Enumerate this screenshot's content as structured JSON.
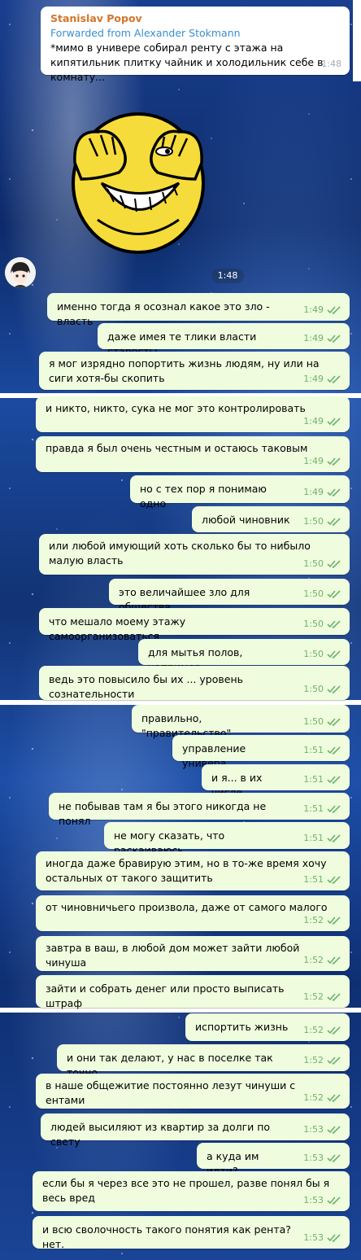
{
  "forwarded": {
    "sender": "Stanislav Popov",
    "forwarded_label": "Forwarded from Alexander Stokmann",
    "text": "*мимо в универе собирал ренту с этажа на кипятильник плитку чайник и холодильник себе в комнату...",
    "time": "1:48"
  },
  "sticker_time": "1:48",
  "messages": [
    {
      "text": "именно тогда я осознал какое это зло - власть",
      "time": "1:49"
    },
    {
      "text": "даже имея те тлики власти старосты",
      "time": "1:49"
    },
    {
      "text": "я мог изрядно попортить жизнь людям, ну или на сиги хотя-бы скопить",
      "time": "1:49"
    },
    {
      "text": "и никто, никто, сука не мог это контролировать",
      "time": "1:49"
    },
    {
      "text": "правда я был очень честным и остаюсь таковым",
      "time": "1:49"
    },
    {
      "text": "но с тех пор я понимаю одно",
      "time": "1:49"
    },
    {
      "text": "любой чиновник",
      "time": "1:50"
    },
    {
      "text": "или любой имующий хоть сколько бы то нибыло малую власть",
      "time": "1:50"
    },
    {
      "text": "это величайшее зло для общества",
      "time": "1:50"
    },
    {
      "text": "что мешало моему этажу самоорганизоваться",
      "time": "1:50"
    },
    {
      "text": "для мытья полов, например",
      "time": "1:50"
    },
    {
      "text": "ведь это повысило бы их ... уровень сознательности",
      "time": "1:50"
    },
    {
      "text": "правильно, \"правительство\"",
      "time": "1:50"
    },
    {
      "text": "управление универа",
      "time": "1:51"
    },
    {
      "text": "и я... в их числе",
      "time": "1:51"
    },
    {
      "text": "не побывав там я бы этого никогда не понял",
      "time": "1:51"
    },
    {
      "text": "не могу сказать, что раскаиваюсь",
      "time": "1:51"
    },
    {
      "text": "иногда даже бравирую этим, но в то-же время хочу остальных от такого защитить",
      "time": "1:51"
    },
    {
      "text": "от чиновничьего произвола, даже от самого малого",
      "time": "1:52"
    },
    {
      "text": "завтра в ваш, в любой дом может зайти любой чинуша",
      "time": "1:52"
    },
    {
      "text": "зайти и собрать денег или просто выписать штраф",
      "time": "1:52"
    },
    {
      "text": "испортить жизнь",
      "time": "1:52"
    },
    {
      "text": "и они так делают, у нас в поселке так точно",
      "time": "1:52"
    },
    {
      "text": "в наше общежитие постоянно лезут чинуши с ентами",
      "time": "1:52"
    },
    {
      "text": "людей высиляют из квартир за долги по свету",
      "time": "1:53"
    },
    {
      "text": "а куда им идти?",
      "time": "1:53"
    },
    {
      "text": "если бы я через все это не прошел, разве понял бы я весь вред",
      "time": "1:53"
    },
    {
      "text": "и всю сволочность такого понятия как рента? нет.",
      "time": "1:53"
    }
  ],
  "colors": {
    "outgoing_bubble": "#effdde",
    "incoming_bubble": "#ffffff",
    "check": "#6fb26b",
    "sender_name": "#d2762a",
    "forward_link": "#3a8fd0"
  },
  "icons": {
    "read_receipt": "double-check-icon",
    "sticker": "trollface-sticker",
    "avatar": "user-avatar"
  }
}
